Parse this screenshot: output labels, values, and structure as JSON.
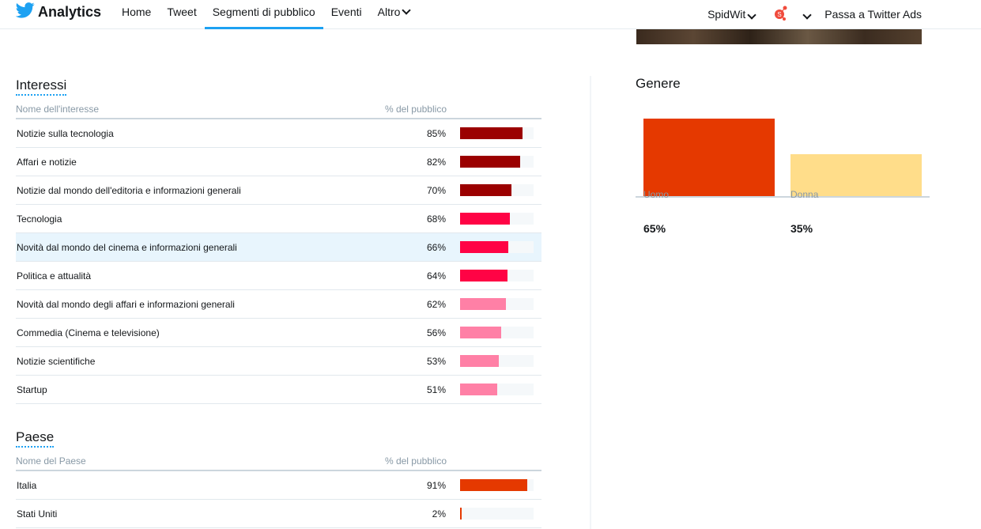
{
  "header": {
    "app_title": "Analytics",
    "nav": [
      {
        "label": "Home",
        "active": false
      },
      {
        "label": "Tweet",
        "active": false
      },
      {
        "label": "Segmenti di pubblico",
        "active": true
      },
      {
        "label": "Eventi",
        "active": false
      },
      {
        "label": "Altro",
        "active": false,
        "dropdown": true
      }
    ],
    "account_name": "SpidWit",
    "ads_link": "Passa a Twitter Ads",
    "icons": [
      "twitter-bird-icon",
      "chevron-down-icon",
      "avatar-icon"
    ]
  },
  "interests": {
    "title": "Interessi",
    "col_name": "Nome dell'interesse",
    "col_pct": "% del pubblico",
    "rows": [
      {
        "name": "Notizie sulla tecnologia",
        "pct_label": "85%",
        "value": 85,
        "color": "#9b0000"
      },
      {
        "name": "Affari e notizie",
        "pct_label": "82%",
        "value": 82,
        "color": "#9b0000"
      },
      {
        "name": "Notizie dal mondo dell'editoria e informazioni generali",
        "pct_label": "70%",
        "value": 70,
        "color": "#9b0000"
      },
      {
        "name": "Tecnologia",
        "pct_label": "68%",
        "value": 68,
        "color": "#ff0345"
      },
      {
        "name": "Novità dal mondo del cinema e informazioni generali",
        "pct_label": "66%",
        "value": 66,
        "color": "#ff0345",
        "highlighted": true
      },
      {
        "name": "Politica e attualità",
        "pct_label": "64%",
        "value": 64,
        "color": "#ff0345"
      },
      {
        "name": "Novità dal mondo degli affari e informazioni generali",
        "pct_label": "62%",
        "value": 62,
        "color": "#ff80a6"
      },
      {
        "name": "Commedia (Cinema e televisione)",
        "pct_label": "56%",
        "value": 56,
        "color": "#ff80a6"
      },
      {
        "name": "Notizie scientifiche",
        "pct_label": "53%",
        "value": 53,
        "color": "#ff80a6"
      },
      {
        "name": "Startup",
        "pct_label": "51%",
        "value": 51,
        "color": "#ff80a6"
      }
    ]
  },
  "countries": {
    "title": "Paese",
    "col_name": "Nome del Paese",
    "col_pct": "% del pubblico",
    "rows": [
      {
        "name": "Italia",
        "pct_label": "91%",
        "value": 91,
        "color": "#e53900"
      },
      {
        "name": "Stati Uniti",
        "pct_label": "2%",
        "value": 2,
        "color": "#e53900"
      }
    ]
  },
  "gender": {
    "title": "Genere",
    "items": [
      {
        "label": "Uomo",
        "pct_label": "65%",
        "value": 65,
        "color": "#e53900"
      },
      {
        "label": "Donna",
        "pct_label": "35%",
        "value": 35,
        "color": "#ffdd8a"
      }
    ]
  },
  "chart_data": [
    {
      "type": "bar",
      "title": "Interessi",
      "categories": [
        "Notizie sulla tecnologia",
        "Affari e notizie",
        "Notizie dal mondo dell'editoria e informazioni generali",
        "Tecnologia",
        "Novità dal mondo del cinema e informazioni generali",
        "Politica e attualità",
        "Novità dal mondo degli affari e informazioni generali",
        "Commedia (Cinema e televisione)",
        "Notizie scientifiche",
        "Startup"
      ],
      "values": [
        85,
        82,
        70,
        68,
        66,
        64,
        62,
        56,
        53,
        51
      ],
      "ylabel": "% del pubblico",
      "ylim": [
        0,
        100
      ]
    },
    {
      "type": "bar",
      "title": "Paese",
      "categories": [
        "Italia",
        "Stati Uniti"
      ],
      "values": [
        91,
        2
      ],
      "ylabel": "% del pubblico",
      "ylim": [
        0,
        100
      ]
    },
    {
      "type": "bar",
      "title": "Genere",
      "categories": [
        "Uomo",
        "Donna"
      ],
      "values": [
        65,
        35
      ],
      "ylim": [
        0,
        65
      ]
    }
  ]
}
